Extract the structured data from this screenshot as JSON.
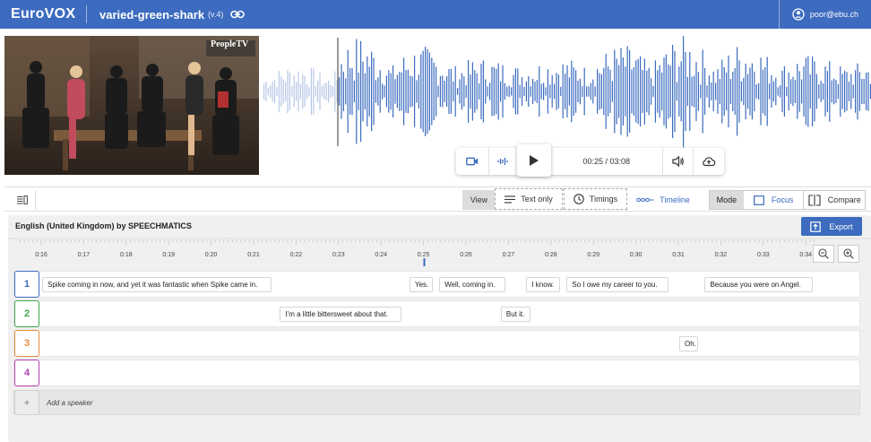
{
  "header": {
    "logo": "EuroVOX",
    "project_name": "varied-green-shark",
    "version": "(v.4)",
    "user_email": "poor@ebu.ch"
  },
  "video": {
    "watermark": "PeopleTV"
  },
  "player": {
    "timecode": "00:25 / 03:08"
  },
  "toolbar": {
    "view_label": "View",
    "text_only": "Text only",
    "timings": "Timings",
    "timeline": "Timeline",
    "mode_label": "Mode",
    "focus": "Focus",
    "compare": "Compare"
  },
  "transcript": {
    "engine_title": "English (United Kingdom) by SPEECHMATICS",
    "export_label": "Export",
    "ruler_ticks": [
      "0:16",
      "0:17",
      "0:18",
      "0:19",
      "0:20",
      "0:21",
      "0:22",
      "0:23",
      "0:24",
      "0:25",
      "0:26",
      "0:27",
      "0:28",
      "0:29",
      "0:30",
      "0:31",
      "0:32",
      "0:33",
      "0:34"
    ],
    "speakers": [
      {
        "number": "1",
        "color": "#3c6bbf",
        "segments": [
          {
            "text": "Spike coming in now, and yet it was fantastic when Spike came in.",
            "start": 16.0,
            "end": 21.4
          },
          {
            "text": "Yes.",
            "start": 24.65,
            "end": 25.2
          },
          {
            "text": "Well, coming in.",
            "start": 25.35,
            "end": 26.9
          },
          {
            "text": "I know.",
            "start": 27.4,
            "end": 28.2
          },
          {
            "text": "So I owe my career to you.",
            "start": 28.35,
            "end": 30.75
          },
          {
            "text": "Because you were on Angel.",
            "start": 31.6,
            "end": 34.15
          }
        ]
      },
      {
        "number": "2",
        "color": "#3fa34d",
        "segments": [
          {
            "text": "I'm a little bittersweet about that.",
            "start": 21.6,
            "end": 24.45
          },
          {
            "text": "But it.",
            "start": 26.8,
            "end": 27.5
          }
        ]
      },
      {
        "number": "3",
        "color": "#e58a3a",
        "segments": [
          {
            "text": "Oh.",
            "start": 31.0,
            "end": 31.45
          }
        ]
      },
      {
        "number": "4",
        "color": "#b13fb0",
        "segments": []
      }
    ],
    "add_speaker_placeholder": "Add a speaker",
    "add_speaker_plus": "+"
  }
}
